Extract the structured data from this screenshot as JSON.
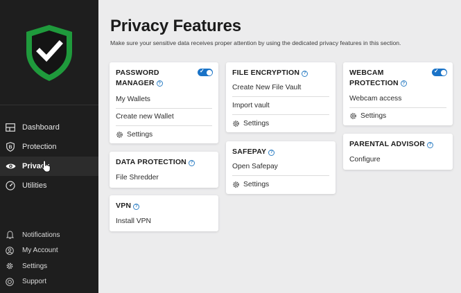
{
  "brand": {
    "accent": "#1f9a3c",
    "toggle_color": "#1a73c7"
  },
  "sidebar": {
    "nav": [
      {
        "label": "Dashboard",
        "icon": "dashboard-icon"
      },
      {
        "label": "Protection",
        "icon": "protection-icon"
      },
      {
        "label": "Privacy",
        "icon": "eye-icon",
        "active": true
      },
      {
        "label": "Utilities",
        "icon": "utilities-icon"
      }
    ],
    "bottom": [
      {
        "label": "Notifications",
        "icon": "bell-icon"
      },
      {
        "label": "My Account",
        "icon": "account-icon"
      },
      {
        "label": "Settings",
        "icon": "gear-icon"
      },
      {
        "label": "Support",
        "icon": "support-icon"
      }
    ]
  },
  "main": {
    "title": "Privacy Features",
    "subtitle": "Make sure your sensitive data receives proper attention by using the dedicated privacy features in this section."
  },
  "cards": {
    "password_manager": {
      "title_line1": "PASSWORD",
      "title_line2": "MANAGER",
      "toggle_on": true,
      "items": [
        "My Wallets",
        "Create new Wallet"
      ],
      "settings": "Settings"
    },
    "data_protection": {
      "title": "DATA PROTECTION",
      "items": [
        "File Shredder"
      ]
    },
    "vpn": {
      "title": "VPN",
      "items": [
        "Install VPN"
      ]
    },
    "file_encryption": {
      "title": "FILE ENCRYPTION",
      "items": [
        "Create New File Vault",
        "Import vault"
      ],
      "settings": "Settings"
    },
    "safepay": {
      "title": "SAFEPAY",
      "items": [
        "Open Safepay"
      ],
      "settings": "Settings"
    },
    "webcam_protection": {
      "title_line1": "WEBCAM",
      "title_line2": "PROTECTION",
      "toggle_on": true,
      "items": [
        "Webcam access"
      ],
      "settings": "Settings"
    },
    "parental_advisor": {
      "title": "PARENTAL ADVISOR",
      "items": [
        "Configure"
      ]
    }
  }
}
